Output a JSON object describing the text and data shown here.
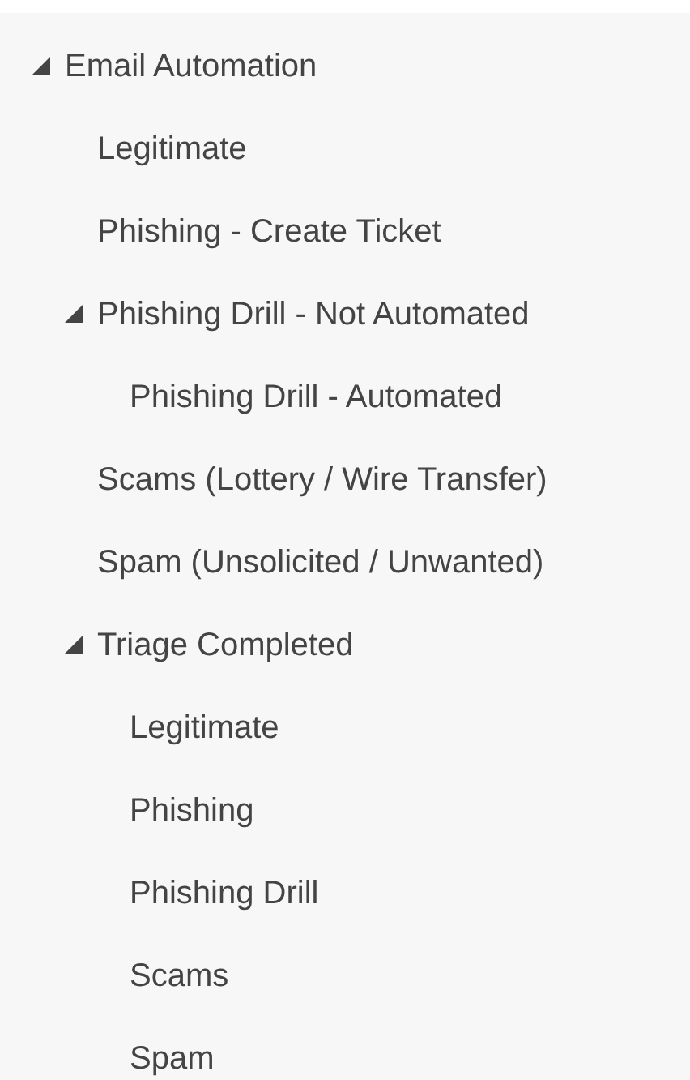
{
  "tree": [
    {
      "label": "Email Automation",
      "expanded": true,
      "children": [
        {
          "label": "Legitimate"
        },
        {
          "label": "Phishing - Create Ticket"
        },
        {
          "label": "Phishing Drill - Not Automated",
          "expanded": true,
          "children": [
            {
              "label": "Phishing Drill - Automated"
            }
          ]
        },
        {
          "label": "Scams (Lottery / Wire Transfer)"
        },
        {
          "label": "Spam (Unsolicited / Unwanted)"
        },
        {
          "label": "Triage Completed",
          "expanded": true,
          "children": [
            {
              "label": "Legitimate"
            },
            {
              "label": "Phishing"
            },
            {
              "label": "Phishing Drill"
            },
            {
              "label": "Scams"
            },
            {
              "label": "Spam"
            }
          ]
        }
      ]
    }
  ]
}
